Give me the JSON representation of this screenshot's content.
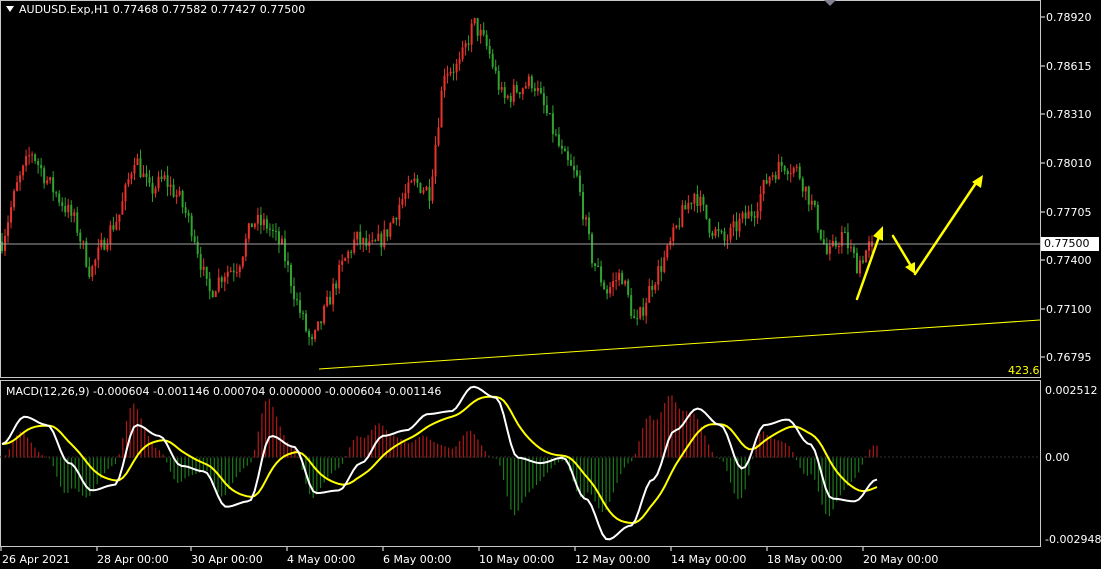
{
  "header": {
    "symbol_line": "AUDUSD.Exp,H1  0.77468 0.77582 0.77427 0.77500",
    "current_price": "0.77500",
    "level_label": "423.6"
  },
  "price_axis": {
    "labels": [
      "0.78920",
      "0.78615",
      "0.78310",
      "0.78010",
      "0.77705",
      "0.77400",
      "0.77100",
      "0.76795"
    ]
  },
  "macd": {
    "label": "MACD(12,26,9) -0.000604 -0.001146 0.000704 0.000000 -0.000604 -0.001146",
    "axis_labels": [
      "0.002512",
      "0.00",
      "-0.002948"
    ]
  },
  "time_axis": {
    "labels": [
      "26 Apr 2021",
      "28 Apr 00:00",
      "30 Apr 00:00",
      "4 May 00:00",
      "6 May 00:00",
      "10 May 00:00",
      "12 May 00:00",
      "14 May 00:00",
      "18 May 00:00",
      "20 May 00:00"
    ]
  },
  "colors": {
    "background": "#000000",
    "bull_candle": "#e8322c",
    "bear_candle": "#2fa52f",
    "trendline": "#ffff00",
    "arrows": "#ffff00",
    "macd_line": "#ffffff",
    "signal_line": "#ffff00",
    "hist_positive": "#b01818",
    "hist_negative": "#1a7a1a"
  },
  "chart_data": {
    "type": "candlestick",
    "symbol": "AUDUSD.Exp",
    "timeframe": "H1",
    "price_path": [
      0.775,
      0.7785,
      0.7808,
      0.779,
      0.7776,
      0.7762,
      0.773,
      0.7752,
      0.7768,
      0.7805,
      0.7782,
      0.779,
      0.7778,
      0.7756,
      0.7716,
      0.773,
      0.7735,
      0.7763,
      0.776,
      0.7746,
      0.7711,
      0.7683,
      0.7708,
      0.7733,
      0.7752,
      0.7745,
      0.7754,
      0.7775,
      0.7788,
      0.7782,
      0.786,
      0.7862,
      0.789,
      0.7872,
      0.784,
      0.7848,
      0.7853,
      0.783,
      0.7805,
      0.779,
      0.774,
      0.7718,
      0.773,
      0.7695,
      0.7722,
      0.774,
      0.7765,
      0.7782,
      0.776,
      0.775,
      0.7762,
      0.777,
      0.7792,
      0.78,
      0.7795,
      0.7772,
      0.774,
      0.7755,
      0.7735,
      0.775
    ],
    "ylim": [
      0.7664,
      0.7902
    ],
    "last_ohlc": {
      "open": 0.77468,
      "high": 0.77582,
      "low": 0.77427,
      "close": 0.775
    },
    "trendline": {
      "start": 0.7672,
      "end": 0.7711
    },
    "macd_values": [
      0.0005,
      0.0015,
      0.0012,
      -0.0002,
      -0.0012,
      -0.001,
      0.0012,
      0.0008,
      -0.0003,
      -0.0005,
      -0.0018,
      -0.0016,
      0.0008,
      0.0004,
      -0.0013,
      -0.0012,
      -0.0002,
      0.0008,
      0.001,
      0.0016,
      0.0017,
      0.0026,
      0.0022,
      0.0,
      -0.0002,
      0.0,
      -0.0015,
      -0.003,
      -0.0025,
      -0.0008,
      0.001,
      0.0018,
      0.0012,
      -0.0004,
      0.0012,
      0.0014,
      0.0005,
      -0.0015,
      -0.0016,
      -0.0008
    ],
    "macd_ylim": [
      -0.0032,
      0.0027
    ]
  }
}
